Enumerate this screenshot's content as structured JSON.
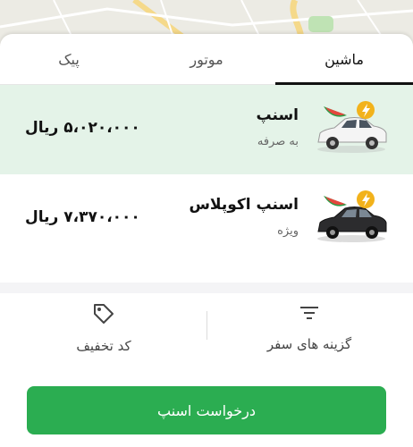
{
  "tabs": {
    "car": "ماشین",
    "motor": "موتور",
    "courier": "پیک"
  },
  "ride_options": [
    {
      "name": "اسنپ",
      "desc": "به صرفه",
      "price": "۵،۰۲۰،۰۰۰ ریال",
      "icon": "eco-car-white-icon"
    },
    {
      "name": "اسنپ اکوپلاس",
      "desc": "ویژه",
      "price": "۷،۳۷۰،۰۰۰ ریال",
      "icon": "eco-car-black-icon"
    }
  ],
  "actions": {
    "trip_options": "گزینه های سفر",
    "discount_code": "کد تخفیف"
  },
  "request_button": "درخواست اسنپ",
  "colors": {
    "accent": "#2bad51",
    "selected_row": "#e4f3e8",
    "badge": "#f2b21b"
  }
}
